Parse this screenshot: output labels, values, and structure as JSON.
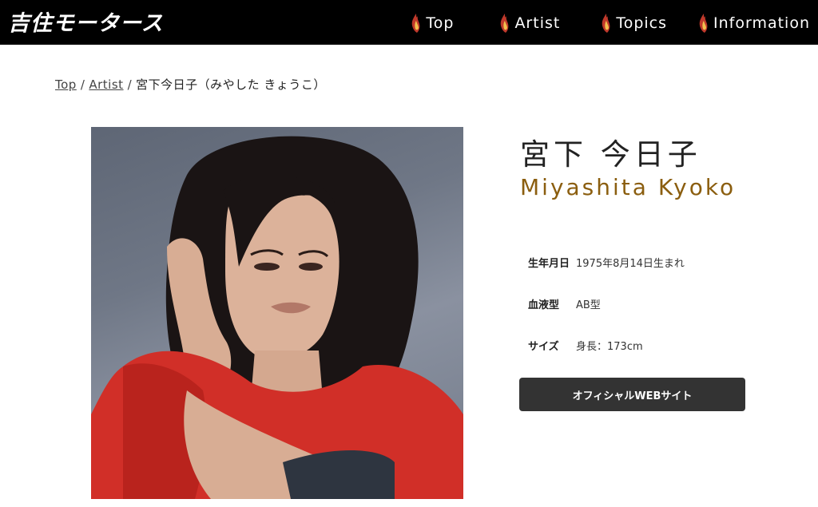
{
  "header": {
    "logo_text": "吉住モータース",
    "nav": [
      {
        "label": "Top",
        "icon": "flame-icon"
      },
      {
        "label": "Artist",
        "icon": "flame-icon"
      },
      {
        "label": "Topics",
        "icon": "flame-icon"
      },
      {
        "label": "Information",
        "icon": "flame-icon"
      }
    ],
    "colors": {
      "bar": "#000000",
      "flame_outer": "#c0392b",
      "flame_inner": "#f2c14e"
    }
  },
  "breadcrumb": {
    "items": [
      "Top",
      "Artist"
    ],
    "separator": "/",
    "current": "宮下今日子（みやした きょうこ）"
  },
  "artist": {
    "name_jp": "宮下 今日子",
    "name_en": "Miyashita Kyoko",
    "name_en_color": "#8b5e0f",
    "photo_alt": "portrait photo",
    "info": [
      {
        "label": "生年月日",
        "value": "1975年8月14日生まれ"
      },
      {
        "label": "血液型",
        "value": "AB型"
      },
      {
        "label": "サイズ",
        "value": "身長：173cm"
      }
    ],
    "official_button": "オフィシャルWEBサイト"
  }
}
